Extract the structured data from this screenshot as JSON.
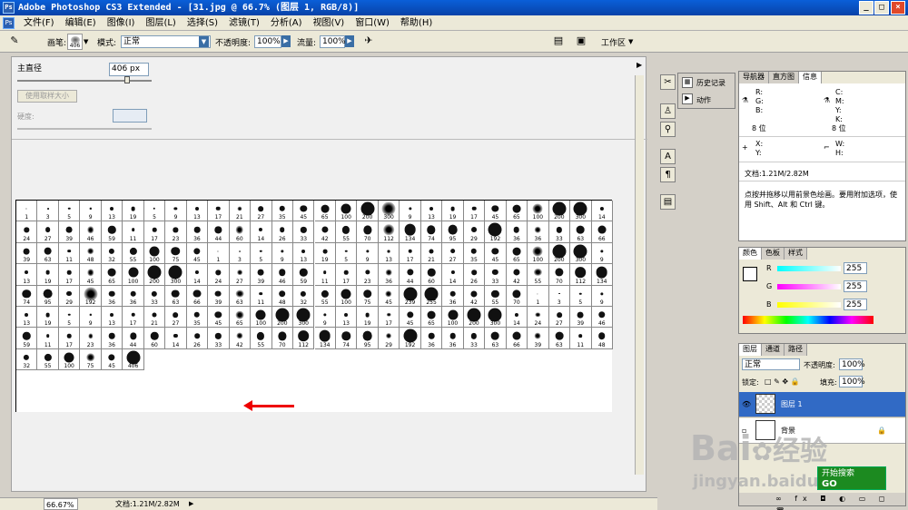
{
  "window": {
    "title": "Adobe Photoshop CS3 Extended - [31.jpg @ 66.7% (图层 1, RGB/8)]",
    "buttons": [
      "_",
      "□",
      "×"
    ]
  },
  "menu": [
    "文件(F)",
    "编辑(E)",
    "图像(I)",
    "图层(L)",
    "选择(S)",
    "滤镜(T)",
    "分析(A)",
    "视图(V)",
    "窗口(W)",
    "帮助(H)"
  ],
  "options": {
    "brush_label": "画笔:",
    "brush_size": "406",
    "mode_label": "模式:",
    "mode_value": "正常",
    "opacity_label": "不透明度:",
    "opacity_value": "100%",
    "flow_label": "流量:",
    "flow_value": "100%",
    "workspace": "工作区"
  },
  "brush_picker": {
    "diameter_label": "主直径",
    "diameter_value": "406 px",
    "sample_button": "使用取样大小",
    "hardness_label": "硬度:",
    "selected_index": 206,
    "sizes": [
      1,
      3,
      5,
      9,
      13,
      19,
      5,
      9,
      13,
      17,
      21,
      27,
      35,
      45,
      65,
      100,
      200,
      300,
      9,
      13,
      19,
      17,
      45,
      65,
      100,
      200,
      300,
      14,
      24,
      27,
      39,
      46,
      59,
      11,
      17,
      23,
      36,
      44,
      60,
      14,
      26,
      33,
      42,
      55,
      70,
      112,
      134,
      74,
      95,
      29,
      192,
      36,
      36,
      33,
      63,
      66,
      39,
      63,
      11,
      48,
      32,
      55,
      100,
      75,
      45,
      1,
      3,
      5,
      9,
      13,
      19,
      5,
      9,
      13,
      17,
      21,
      27,
      35,
      45,
      65,
      100,
      200,
      300,
      9,
      13,
      19,
      17,
      45,
      65,
      100,
      200,
      300,
      14,
      24,
      27,
      39,
      46,
      59,
      11,
      17,
      23,
      36,
      44,
      60,
      14,
      26,
      33,
      42,
      55,
      70,
      112,
      134,
      74,
      95,
      29,
      192,
      36,
      36,
      33,
      63,
      66,
      39,
      63,
      11,
      48,
      32,
      55,
      100,
      75,
      45,
      239,
      255,
      36,
      42,
      55,
      70,
      1,
      3,
      5,
      9,
      13,
      19,
      5,
      9,
      13,
      17,
      21,
      27,
      35,
      45,
      65,
      100,
      200,
      300,
      9,
      13,
      19,
      17,
      45,
      65,
      100,
      200,
      300,
      14,
      24,
      27,
      39,
      46,
      59,
      11,
      17,
      23,
      36,
      44,
      60,
      14,
      26,
      33,
      42,
      55,
      70,
      112,
      134,
      74,
      95,
      29,
      192,
      36,
      36,
      33,
      63,
      66,
      39,
      63,
      11,
      48,
      32,
      55,
      100,
      75,
      45,
      406
    ]
  },
  "status": {
    "zoom": "66.67%",
    "doc": "文档:1.21M/2.82M"
  },
  "history_panel": {
    "items": [
      "历史记录",
      "动作"
    ]
  },
  "info_panel": {
    "tabs": [
      "导航器",
      "直方图",
      "信息"
    ],
    "rgb": [
      "R:",
      "G:",
      "B:"
    ],
    "cmyk": [
      "C:",
      "M:",
      "Y:",
      "K:"
    ],
    "bit1": "8 位",
    "bit2": "8 位",
    "xy": [
      "X:",
      "Y:"
    ],
    "wh": [
      "W:",
      "H:"
    ],
    "doc": "文档:1.21M/2.82M",
    "hint": "点按并拖移以用前景色绘画。要用附加选项，使用 Shift、Alt 和 Ctrl 键。"
  },
  "color_panel": {
    "tabs": [
      "颜色",
      "色板",
      "样式"
    ],
    "channels": [
      {
        "label": "R",
        "value": "255",
        "color": "#00e0e0"
      },
      {
        "label": "G",
        "value": "255",
        "color": "#e000e0"
      },
      {
        "label": "B",
        "value": "255",
        "color": "#e0e000"
      }
    ]
  },
  "layers_panel": {
    "tabs": [
      "图层",
      "通道",
      "路径"
    ],
    "mode": "正常",
    "opacity_label": "不透明度:",
    "opacity_value": "100%",
    "lock_label": "锁定:",
    "fill_label": "填充:",
    "fill_value": "100%",
    "layers": [
      "图层 1",
      "背景"
    ],
    "accent": "#316ac5"
  },
  "watermark": {
    "brand": "Bai",
    "brand2": "经验",
    "url": "jingyan.baidu.com",
    "badge1": "开始搜索",
    "badge2": "GO"
  }
}
